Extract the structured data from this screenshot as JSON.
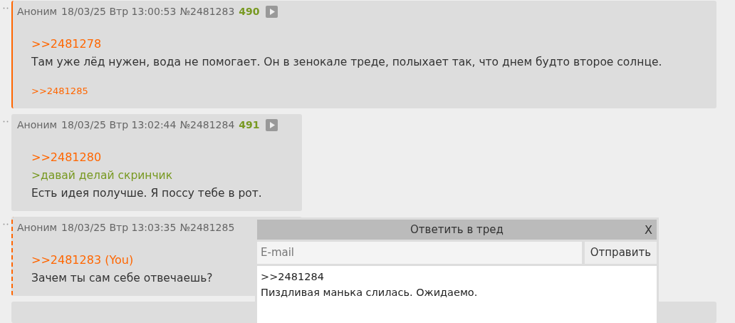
{
  "posts": [
    {
      "author": "Аноним",
      "datetime": "18/03/25 Втр 13:00:53",
      "number": "№2481283",
      "ordinal": "490",
      "own": true,
      "replies_to_you": false,
      "wide": true,
      "body": [
        {
          "kind": "link",
          "text": ">>2481278"
        },
        {
          "kind": "text",
          "text": "Там уже лёд нужен, вода не помогает. Он в зенокале треде, полыхает так, что днем будто второе солнце."
        }
      ],
      "replies": [
        ">>2481285"
      ]
    },
    {
      "author": "Аноним",
      "datetime": "18/03/25 Втр 13:02:44",
      "number": "№2481284",
      "ordinal": "491",
      "own": false,
      "replies_to_you": false,
      "wide": false,
      "body": [
        {
          "kind": "link",
          "text": ">>2481280"
        },
        {
          "kind": "quote",
          "text": ">давай делай скринчик"
        },
        {
          "kind": "text",
          "text": "Есть идея получше. Я поссу тебе в рот."
        }
      ]
    },
    {
      "author": "Аноним",
      "datetime": "18/03/25 Втр 13:03:35",
      "number": "№2481285",
      "own": false,
      "replies_to_you": true,
      "wide": false,
      "body": [
        {
          "kind": "link",
          "text": ">>2481283 (You)"
        },
        {
          "kind": "text",
          "text": "Зачем ты сам себе отвечаешь?"
        }
      ]
    }
  ],
  "reply_form": {
    "title": "Ответить в тред",
    "close": "X",
    "email": {
      "placeholder": "E-mail"
    },
    "submit": "Отправить",
    "message": {
      "value": ">>2481284\nПиздливая манька слилась. Ожидаемо.\n"
    }
  }
}
